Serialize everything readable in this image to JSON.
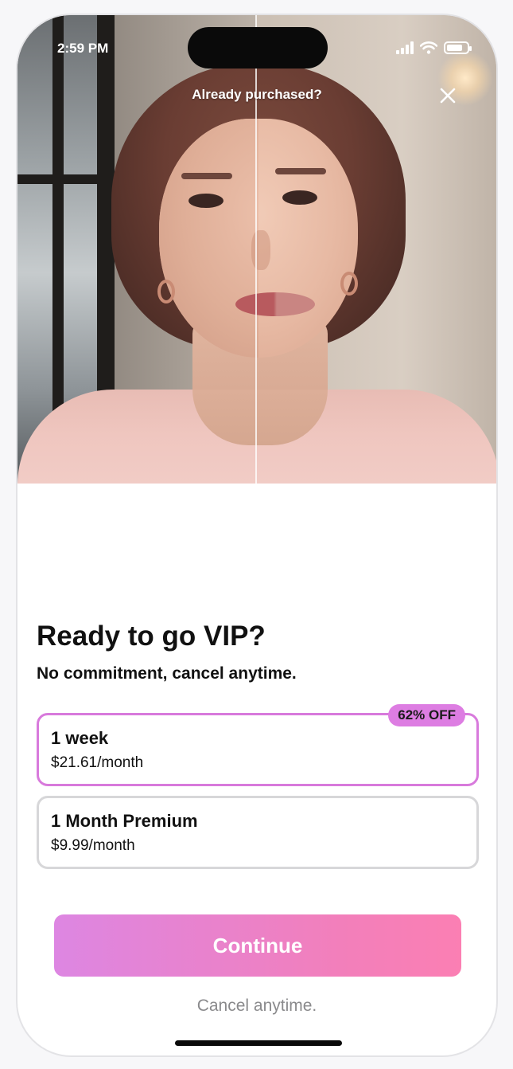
{
  "status_bar": {
    "time": "2:59 PM"
  },
  "header": {
    "restore_link": "Already purchased?",
    "close_icon": "close-icon"
  },
  "main": {
    "title": "Ready to go VIP?",
    "subtitle": "No commitment, cancel anytime."
  },
  "plans": [
    {
      "name": "1 week",
      "price": "$21.61/month",
      "badge": "62% OFF",
      "selected": true
    },
    {
      "name": "1 Month Premium",
      "price": "$9.99/month",
      "selected": false
    }
  ],
  "cta": {
    "label": "Continue"
  },
  "footer": {
    "note": "Cancel anytime."
  },
  "colors": {
    "accent": "#dd7de2",
    "cta_start": "#dd86e2",
    "cta_end": "#fb7fb3",
    "border": "#d7d7d9"
  }
}
